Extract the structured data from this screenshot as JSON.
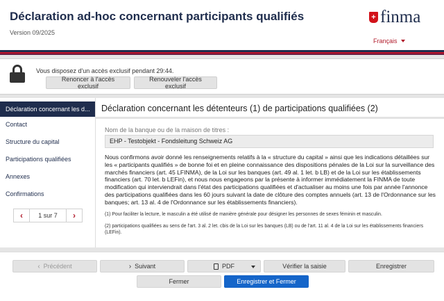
{
  "header": {
    "title": "Déclaration ad-hoc concernant participants qualifiés",
    "version": "Version 09/2025",
    "logo_text": "finma",
    "language": "Français"
  },
  "lock": {
    "message": "Vous disposez d'un accès exclusif pendant 29:44.",
    "renounce_label": "Renoncer à l'accès exclusif",
    "renew_label": "Renouveler l'accès exclusif"
  },
  "sidebar": {
    "items": [
      {
        "label": "Déclaration concernant les d..."
      },
      {
        "label": "Contact"
      },
      {
        "label": "Structure du capital"
      },
      {
        "label": "Participations qualifiées"
      },
      {
        "label": "Annexes"
      },
      {
        "label": "Confirmations"
      }
    ],
    "pager": {
      "label": "1 sur 7",
      "prev": "‹",
      "next": "›"
    }
  },
  "main": {
    "title": "Déclaration concernant les détenteurs (1) de participations qualifiées (2)",
    "bank_label": "Nom de la banque ou de la maison de titres :",
    "bank_value": "EHP - Testobjekt - Fondsleitung Schweiz AG",
    "paragraph": "Nous confirmons avoir donné les renseignements relatifs à la « structure du capital » ainsi que les indications détaillées sur les « participants qualifiés » de bonne foi et en pleine connaissance des dispositions pénales de la Loi sur la surveillance des marchés financiers (art. 45 LFINMA), de la Loi sur les banques (art. 49 al. 1 let. b LB) et de la Loi sur les établissements financiers (art. 70 let. b LEFin), et nous nous engageons par la présente à informer immédiatement la FINMA de toute modification qui interviendrait dans l'état des participations qualifiées et d'actualiser au moins une fois par année l'annonce des participations qualifiées dans les 60 jours suivant la date de clôture des comptes annuels (art. 13 de l'Ordonnance sur les banques; art. 13 al. 4 de l'Ordonnance sur les établissements financiers).",
    "footnote1": "(1) Pour faciliter la lecture, le masculin a été utilisé de manière générale pour désigner les personnes de sexes féminin et masculin.",
    "footnote2": "(2) participations qualifiées au sens de l'art. 3 al. 2 let. cbis de la Loi sur les banques (LB) ou de l'art. 11 al. 4 de la Loi sur les établissements financiers (LEFin)."
  },
  "footer": {
    "previous": "Précédent",
    "next": "Suivant",
    "pdf": "PDF",
    "verify": "Vérifier la saisie",
    "save": "Enregistrer",
    "close": "Fermer",
    "save_close": "Enregistrer et Fermer"
  },
  "colors": {
    "navy": "#1f2d4d",
    "red": "#c0122a",
    "primary_blue": "#1565c9"
  }
}
